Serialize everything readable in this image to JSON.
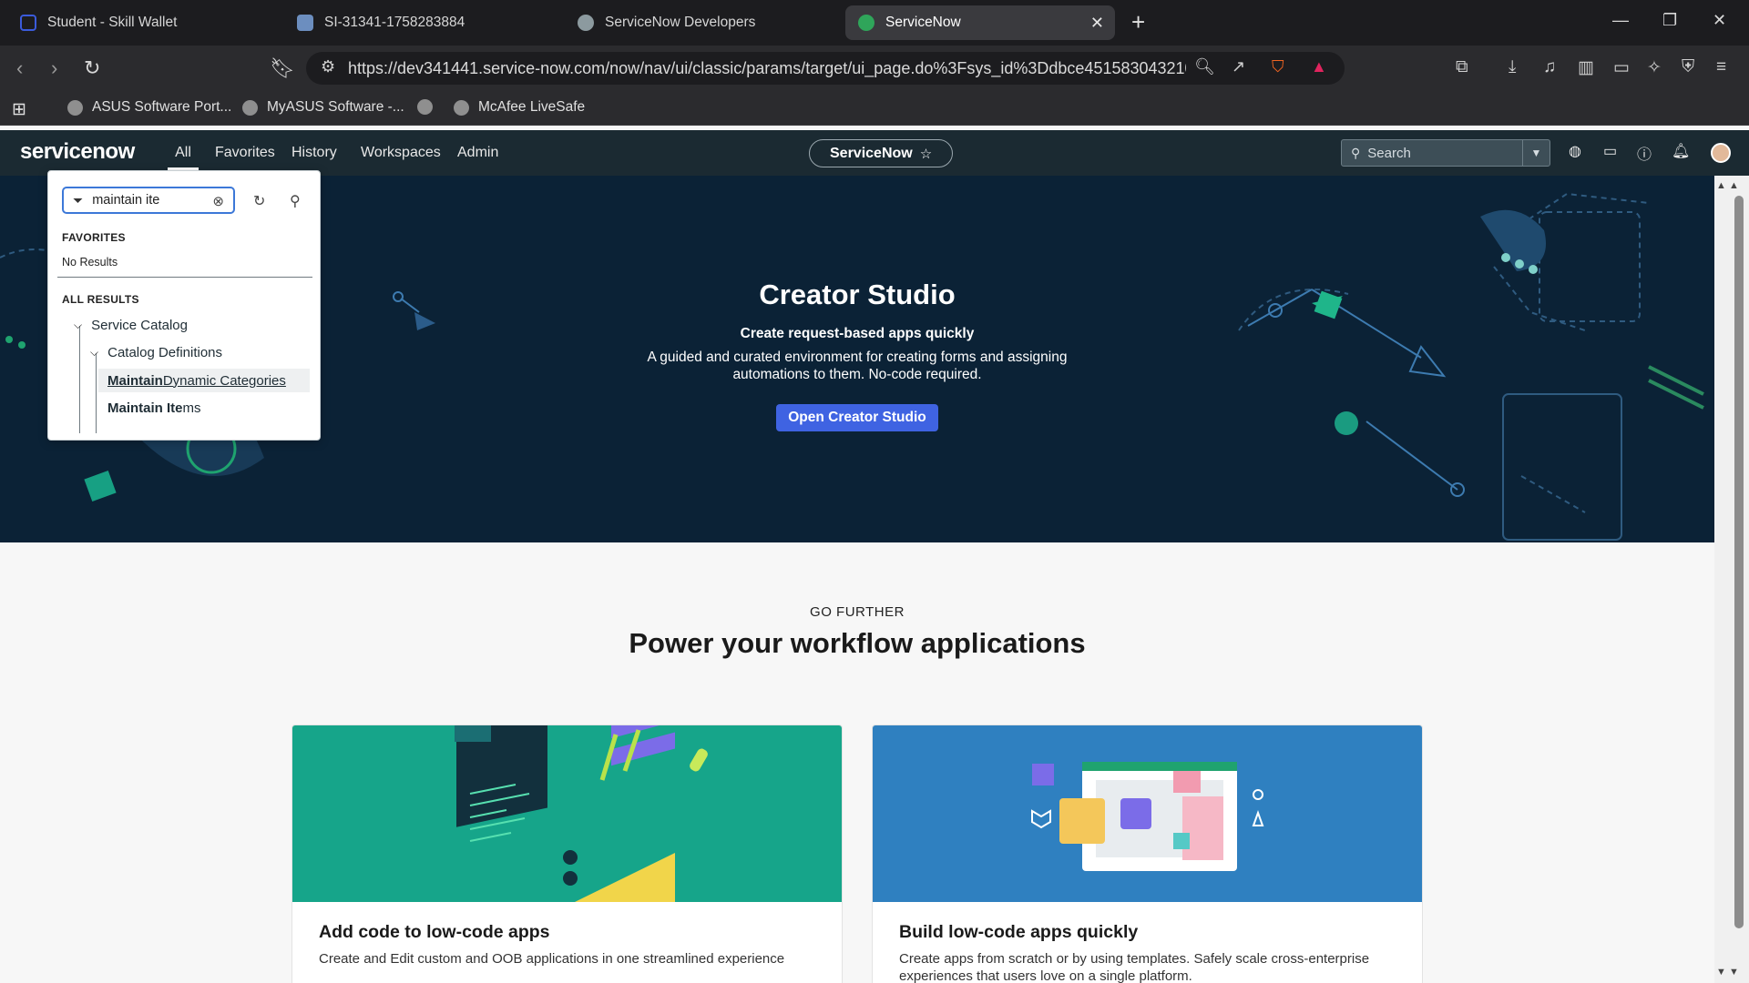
{
  "browser": {
    "tabs": [
      {
        "label": "Student - Skill Wallet",
        "color": "#3b5bdb"
      },
      {
        "label": "SI-31341-1758283884",
        "color": "#6c8ebf"
      },
      {
        "label": "ServiceNow Developers",
        "color": "#7f8c8d"
      },
      {
        "label": "ServiceNow",
        "color": "#2fa55a"
      }
    ],
    "url": "https://dev341441.service-now.com/now/nav/ui/classic/params/target/ui_page.do%3Fsys_id%3Ddbce451583043210...",
    "bookmarks": [
      {
        "label": "ASUS Software Port..."
      },
      {
        "label": "MyASUS Software -..."
      },
      {
        "label": ""
      },
      {
        "label": "McAfee LiveSafe"
      }
    ]
  },
  "header": {
    "logo": "servicenow",
    "nav": [
      "All",
      "Favorites",
      "History",
      "Workspaces",
      "Admin"
    ],
    "context_pill": "ServiceNow",
    "search_placeholder": "Search"
  },
  "hero": {
    "title": "Creator Studio",
    "subtitle": "Create request-based apps quickly",
    "description": "A guided and curated environment for creating forms and assigning automations to them. No-code required.",
    "button": "Open Creator Studio"
  },
  "go_further": {
    "eyebrow": "GO FURTHER",
    "title": "Power your workflow applications",
    "cards": [
      {
        "title": "Add code to low-code apps",
        "description": "Create and Edit custom and OOB applications in one streamlined experience"
      },
      {
        "title": "Build low-code apps quickly",
        "description": "Create apps from scratch or by using templates. Safely scale cross-enterprise experiences that users love on a single platform."
      }
    ]
  },
  "menu": {
    "filter_value": "maintain ite",
    "favorites_label": "FAVORITES",
    "no_results": "No Results",
    "all_results_label": "ALL RESULTS",
    "tree": {
      "app": "Service Catalog",
      "module": "Catalog Definitions",
      "items": [
        {
          "match": "Maintain",
          "rest": " Dynamic Categories"
        },
        {
          "match": "Maintain Ite",
          "rest": "ms"
        }
      ]
    }
  },
  "colors": {
    "hero_bg": "#0b2236",
    "accent": "#3f63e2",
    "sn_bar": "#1b2a32",
    "card1_art": "#16a58a",
    "card2_art": "#2f80c0"
  }
}
